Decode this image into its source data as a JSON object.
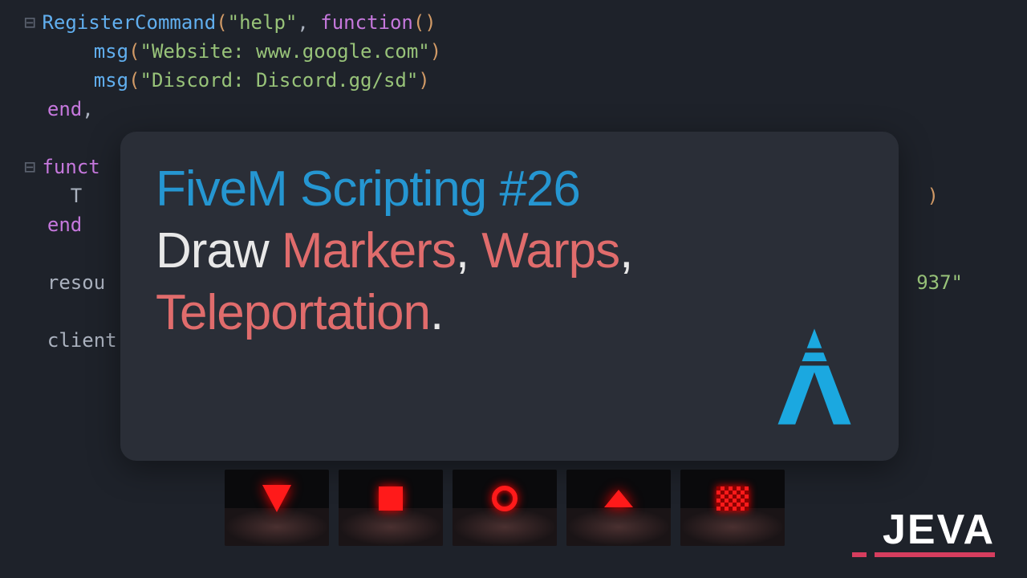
{
  "code": {
    "l1_fn": "RegisterCommand",
    "l1_arg1": "\"help\"",
    "l1_kw": "function",
    "l2_fn": "msg",
    "l2_str": "\"Website: www.google.com\"",
    "l3_fn": "msg",
    "l3_str": "\"Discord: Discord.gg/sd\"",
    "l4": "end",
    "l4_comma": ",",
    "l5_kw": "funct",
    "l6": "    T",
    "l6_rparen": ")",
    "l7": "end",
    "l8": "resou",
    "l8_tail": "937\"",
    "l9": "client"
  },
  "overlay": {
    "line1": "FiveM Scripting #26",
    "line2_a": "Draw",
    "line2_b": "Markers",
    "line2_c": ",",
    "line2_d": "Warps",
    "line2_e": ",",
    "line3_a": "Teleportation",
    "line3_b": "."
  },
  "brand": "JEVA",
  "thumbs": [
    {
      "name": "marker-triangle"
    },
    {
      "name": "marker-square"
    },
    {
      "name": "marker-ring"
    },
    {
      "name": "marker-chevron"
    },
    {
      "name": "marker-checker"
    }
  ]
}
